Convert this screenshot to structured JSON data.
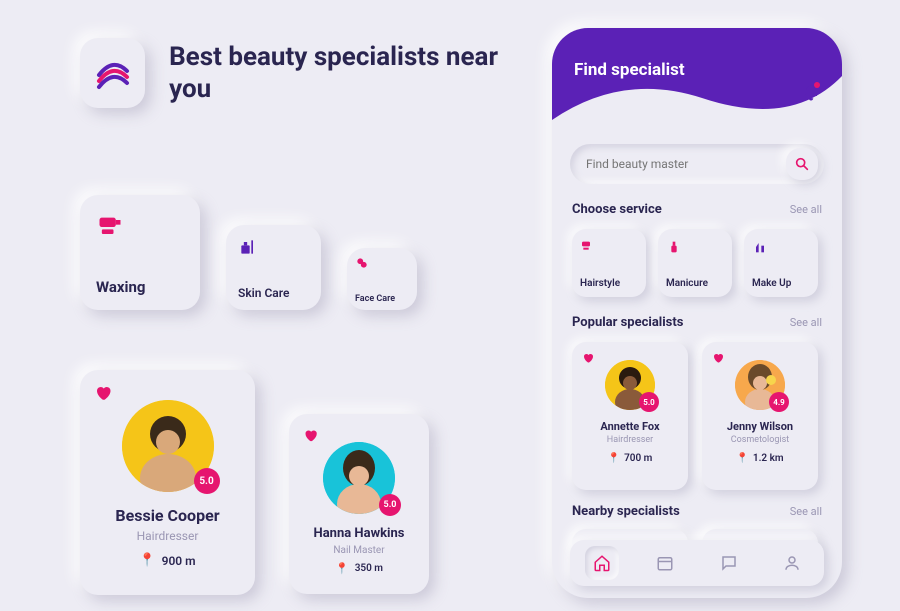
{
  "headline": "Best beauty specialists near you",
  "services_large": [
    {
      "label": "Waxing",
      "icon": "hairdryer-icon"
    },
    {
      "label": "Skin Care",
      "icon": "skincare-icon"
    },
    {
      "label": "Face Care",
      "icon": "facecare-icon"
    }
  ],
  "specialists_large": [
    {
      "name": "Bessie Cooper",
      "role": "Hairdresser",
      "rating": "5.0",
      "distance": "900 m"
    },
    {
      "name": "Hanna Hawkins",
      "role": "Nail Master",
      "rating": "5.0",
      "distance": "350 m"
    }
  ],
  "phone": {
    "header_title": "Find specialist",
    "search_placeholder": "Find beauty master",
    "sections": {
      "choose_service": {
        "title": "Choose service",
        "see_all": "See all"
      },
      "popular": {
        "title": "Popular specialists",
        "see_all": "See all"
      },
      "nearby": {
        "title": "Nearby specialists",
        "see_all": "See all"
      }
    },
    "services": [
      {
        "label": "Hairstyle"
      },
      {
        "label": "Manicure"
      },
      {
        "label": "Make Up"
      }
    ],
    "popular": [
      {
        "name": "Annette Fox",
        "role": "Hairdresser",
        "rating": "5.0",
        "distance": "700 m"
      },
      {
        "name": "Jenny Wilson",
        "role": "Cosmetologist",
        "rating": "4.9",
        "distance": "1.2 km"
      }
    ]
  },
  "colors": {
    "purple": "#5b21b6",
    "pink": "#e6156f",
    "text": "#2a2550",
    "muted": "#9a96b3"
  }
}
